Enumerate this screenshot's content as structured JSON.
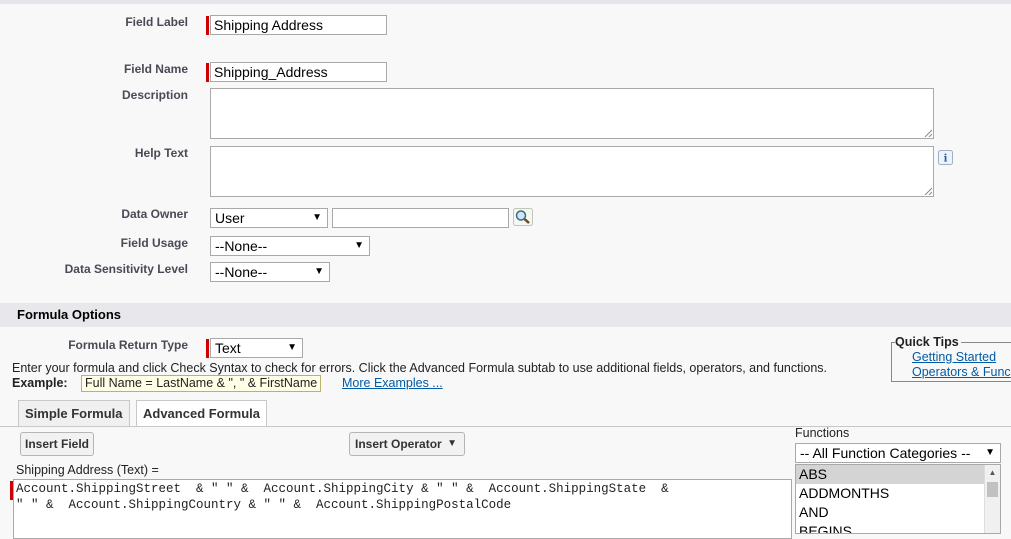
{
  "fields": {
    "field_label": {
      "label": "Field Label",
      "value": "Shipping Address"
    },
    "field_name": {
      "label": "Field Name",
      "value": "Shipping_Address"
    },
    "description": {
      "label": "Description"
    },
    "help_text": {
      "label": "Help Text"
    },
    "data_owner": {
      "label": "Data Owner",
      "selected": "User"
    },
    "field_usage": {
      "label": "Field Usage",
      "selected": "--None--"
    },
    "data_sensitivity": {
      "label": "Data Sensitivity Level",
      "selected": "--None--"
    }
  },
  "formula_options": {
    "title": "Formula Options",
    "return_type_label": "Formula Return Type",
    "return_type": "Text",
    "instructions": "Enter your formula and click Check Syntax to check for errors. Click the Advanced Formula subtab to use additional fields, operators, and functions.",
    "example_label": "Example:",
    "example_value": "Full Name = LastName & \", \" & FirstName",
    "more_examples": "More Examples ..."
  },
  "quick_tips": {
    "title": "Quick Tips",
    "links": [
      "Getting Started",
      "Operators & Func"
    ]
  },
  "tabs": [
    "Simple Formula",
    "Advanced Formula"
  ],
  "buttons": {
    "insert_field": "Insert Field",
    "insert_operator": "Insert Operator"
  },
  "formula": {
    "field_caption": "Shipping Address (Text) =",
    "line1": "Account.ShippingStreet  & \" \" &  Account.ShippingCity & \" \" &  Account.ShippingState  &",
    "line2": "\" \" &  Account.ShippingCountry & \" \" &  Account.ShippingPostalCode"
  },
  "functions": {
    "label": "Functions",
    "category": "-- All Function Categories --",
    "items": [
      "ABS",
      "ADDMONTHS",
      "AND",
      "BEGINS"
    ]
  },
  "colors": {
    "required": "#cc0000",
    "link": "#015ba7",
    "section_bar": "#e8e8ec"
  }
}
